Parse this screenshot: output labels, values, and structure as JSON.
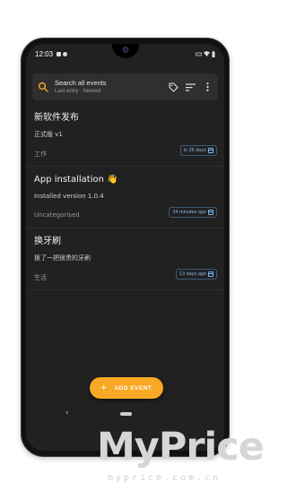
{
  "status_bar": {
    "time": "12:03"
  },
  "search": {
    "placeholder": "Search all events",
    "subtitle": "Last entry · Newest"
  },
  "events": [
    {
      "title": "新软件发布",
      "description": "正式版 v1",
      "category": "工作",
      "relative_time": "in 26 days"
    },
    {
      "title": "App installation 👋",
      "description": "Installed version 1.0.4",
      "category": "Uncategorised",
      "relative_time": "34 minutes ago"
    },
    {
      "title": "换牙刷",
      "description": "换了一把很贵的牙刷",
      "category": "生活",
      "relative_time": "13 days ago"
    }
  ],
  "fab": {
    "label": "ADD EVENT"
  },
  "icons": {
    "search": "search-icon",
    "tag": "tag-icon",
    "sort": "sort-icon",
    "more": "more-vert-icon",
    "calendar": "calendar-icon"
  },
  "colors": {
    "background": "#212121",
    "accent": "#f9a825",
    "time_chip": "#7fb6ea"
  },
  "watermark": {
    "brand": "MyPrice",
    "domain": "myprice.com.cn"
  }
}
